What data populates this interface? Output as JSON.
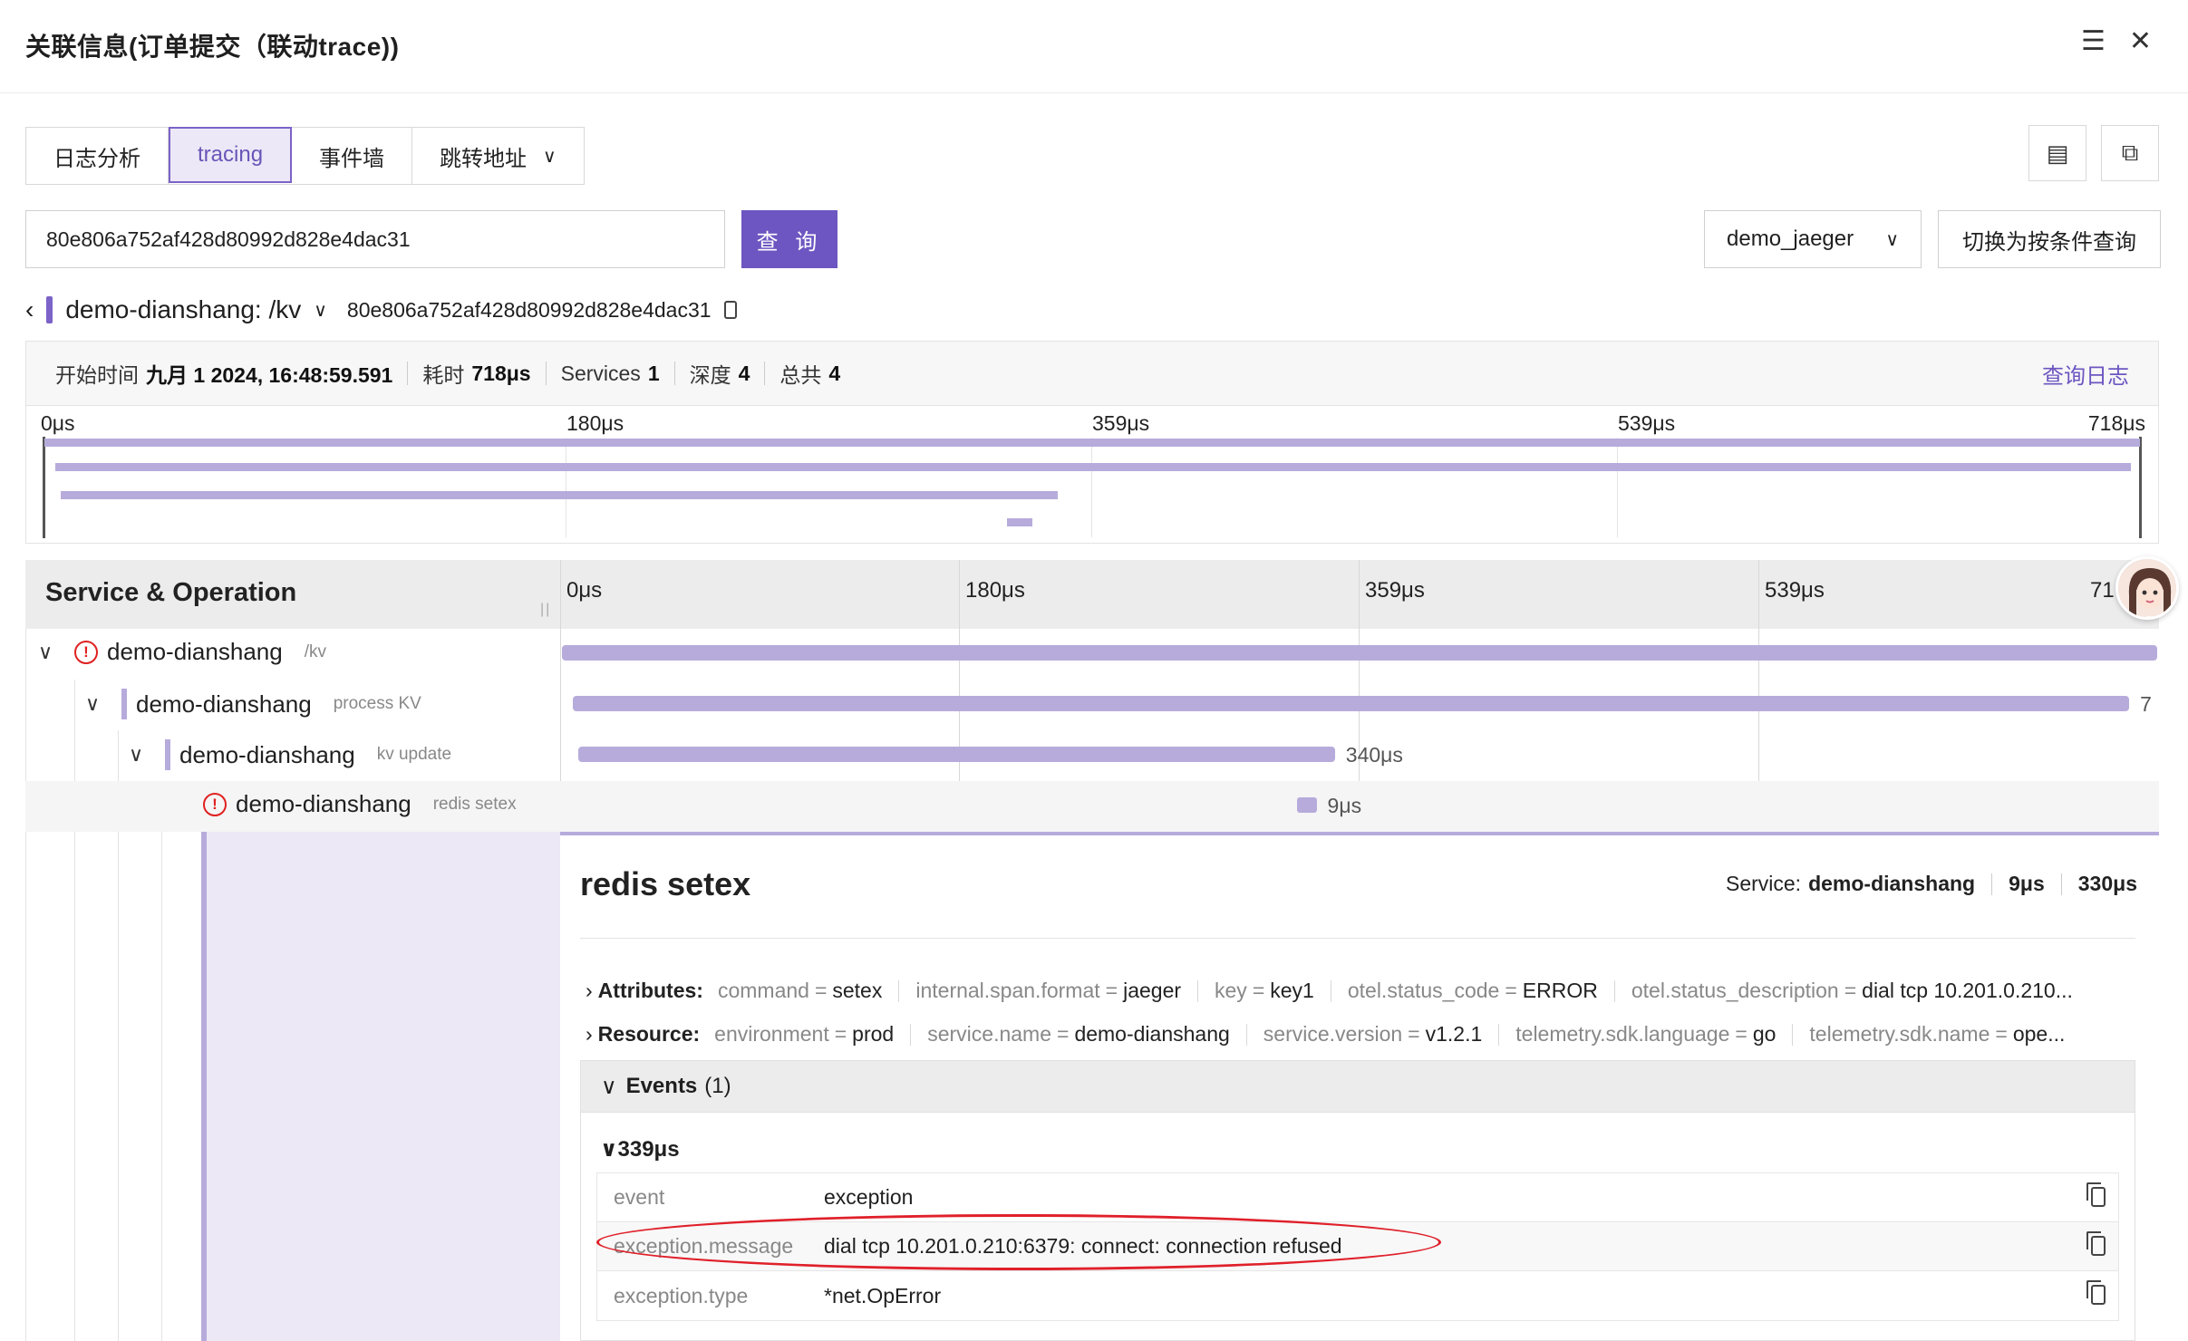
{
  "panel": {
    "title": "关联信息(订单提交（联动trace))"
  },
  "header_icons": [
    "indent-icon",
    "close-icon"
  ],
  "tabs": [
    {
      "label": "日志分析",
      "active": false
    },
    {
      "label": "tracing",
      "active": true
    },
    {
      "label": "事件墙",
      "active": false
    },
    {
      "label": "跳转地址",
      "active": false,
      "dropdown": true
    }
  ],
  "view_buttons": [
    "list-view-icon",
    "graph-view-icon"
  ],
  "search": {
    "value": "80e806a752af428d80992d828e4dac31",
    "button_label": "查 询"
  },
  "datasource": {
    "selected": "demo_jaeger"
  },
  "switch_button": "切换为按条件查询",
  "trace": {
    "title": "demo-dianshang: /kv",
    "trace_id": "80e806a752af428d80992d828e4dac31"
  },
  "summary": {
    "start_label": "开始时间",
    "start_value": "九月 1 2024, 16:48:59.591",
    "duration_label": "耗时",
    "duration_value": "718μs",
    "services_label": "Services",
    "services_value": "1",
    "depth_label": "深度",
    "depth_value": "4",
    "total_label": "总共",
    "total_value": "4",
    "log_link": "查询日志"
  },
  "minimap": {
    "ticks": [
      "0μs",
      "180μs",
      "359μs",
      "539μs",
      "718μs"
    ]
  },
  "timeline": {
    "column_title": "Service & Operation",
    "ticks": [
      "0μs",
      "180μs",
      "359μs",
      "539μs",
      "71"
    ]
  },
  "spans": [
    {
      "service": "demo-dianshang",
      "operation": "/kv",
      "error": true,
      "start_fraction": 0.0,
      "duration_fraction": 1.0,
      "duration_label": ""
    },
    {
      "service": "demo-dianshang",
      "operation": "process KV",
      "error": false,
      "start_fraction": 0.007,
      "duration_fraction": 0.98,
      "duration_label": "7"
    },
    {
      "service": "demo-dianshang",
      "operation": "kv update",
      "error": false,
      "start_fraction": 0.01,
      "duration_fraction": 0.474,
      "duration_label": "340μs"
    },
    {
      "service": "demo-dianshang",
      "operation": "redis setex",
      "error": true,
      "start_fraction": 0.46,
      "duration_fraction": 0.0125,
      "duration_label": "9μs"
    }
  ],
  "detail": {
    "title": "redis setex",
    "service_label": "Service:",
    "service_value": "demo-dianshang",
    "duration": "9μs",
    "start": "330μs",
    "attributes_label": "Attributes:",
    "attributes": [
      {
        "k": "command",
        "v": "setex"
      },
      {
        "k": "internal.span.format",
        "v": "jaeger"
      },
      {
        "k": "key",
        "v": "key1"
      },
      {
        "k": "otel.status_code",
        "v": "ERROR"
      },
      {
        "k": "otel.status_description",
        "v": "dial tcp 10.201.0.210..."
      }
    ],
    "resource_label": "Resource:",
    "resource": [
      {
        "k": "environment",
        "v": "prod"
      },
      {
        "k": "service.name",
        "v": "demo-dianshang"
      },
      {
        "k": "service.version",
        "v": "v1.2.1"
      },
      {
        "k": "telemetry.sdk.language",
        "v": "go"
      },
      {
        "k": "telemetry.sdk.name",
        "v": "ope..."
      }
    ],
    "events_label": "Events",
    "events_count": "(1)",
    "event_time": "339μs",
    "event_rows": [
      {
        "k": "event",
        "v": "exception"
      },
      {
        "k": "exception.message",
        "v": "dial tcp 10.201.0.210:6379: connect: connection refused"
      },
      {
        "k": "exception.type",
        "v": "*net.OpError"
      }
    ]
  },
  "colors": {
    "accent": "#6d56c1",
    "span_bar": "#b7abdb",
    "error": "#e02020",
    "highlight_oval": "#e0202a"
  }
}
